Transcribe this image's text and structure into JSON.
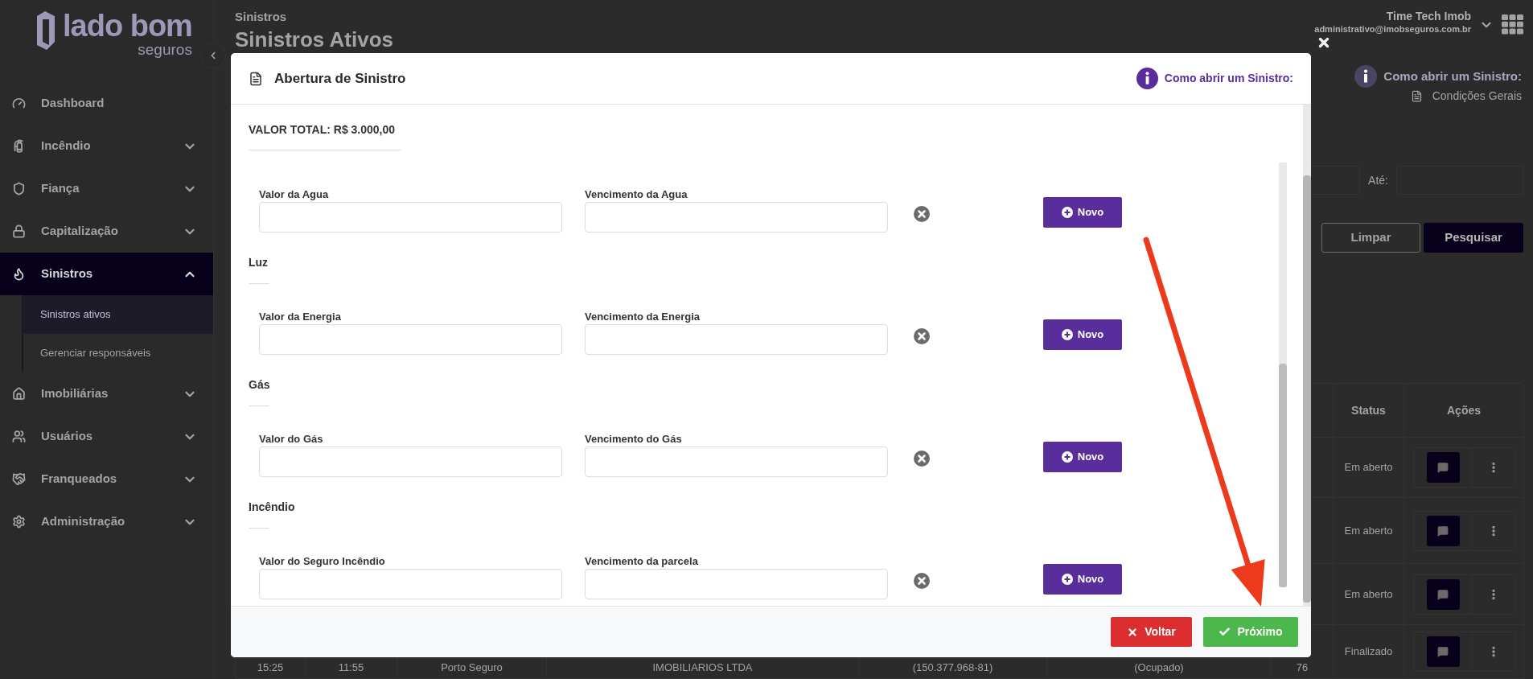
{
  "sidebar": {
    "logo": {
      "wordmark": "lado bom",
      "tagline": "seguros"
    },
    "items": [
      {
        "label": "Dashboard",
        "expandable": false,
        "selected": false
      },
      {
        "label": "Incêndio",
        "expandable": true,
        "expanded": false,
        "selected": false
      },
      {
        "label": "Fiança",
        "expandable": true,
        "expanded": false,
        "selected": false
      },
      {
        "label": "Capitalização",
        "expandable": true,
        "expanded": false,
        "selected": false
      },
      {
        "label": "Sinistros",
        "expandable": true,
        "expanded": true,
        "selected": true,
        "children": [
          {
            "label": "Sinistros ativos",
            "selected": true
          },
          {
            "label": "Gerenciar responsáveis",
            "selected": false
          }
        ]
      },
      {
        "label": "Imobiliárias",
        "expandable": true,
        "expanded": false,
        "selected": false
      },
      {
        "label": "Usuários",
        "expandable": true,
        "expanded": false,
        "selected": false
      },
      {
        "label": "Franqueados",
        "expandable": true,
        "expanded": false,
        "selected": false
      },
      {
        "label": "Administração",
        "expandable": true,
        "expanded": false,
        "selected": false
      }
    ]
  },
  "header": {
    "breadcrumb": "Sinistros",
    "title": "Sinistros Ativos",
    "user": {
      "name": "Time Tech Imob",
      "email": "administrativo@imobseguros.com.br"
    }
  },
  "help": {
    "label": "Como abrir um Sinistro:",
    "link": "Condições Gerais"
  },
  "filters": {
    "until_label": "Até:",
    "buttons": [
      {
        "label": "Limpar",
        "kind": "outline"
      },
      {
        "label": "Pesquisar",
        "kind": "primary"
      }
    ]
  },
  "table": {
    "columns": [
      "Status",
      "Ações"
    ],
    "rows": [
      {
        "status": "Em aberto",
        "cells": []
      },
      {
        "status": "Em aberto",
        "cells": []
      },
      {
        "status": "Em aberto",
        "cells": []
      },
      {
        "status": "Finalizado",
        "cells": [
          [
            "15:25"
          ],
          [
            "11:55"
          ],
          [
            "Porto Seguro"
          ],
          [
            "IMOBILIARIOS LTDA"
          ],
          [
            "(150.377.968-81)"
          ],
          [
            "(Ocupado)"
          ],
          [
            "76"
          ]
        ]
      }
    ]
  },
  "modal": {
    "title": "Abertura de Sinistro",
    "help_link": "Como abrir um Sinistro:",
    "total": "VALOR TOTAL: R$ 3.000,00",
    "sections": [
      {
        "fields": [
          {
            "label": "Valor da Agua"
          },
          {
            "label": "Vencimento da Agua"
          }
        ],
        "action": "Novo"
      },
      {
        "heading": "Luz",
        "fields": [
          {
            "label": "Valor da Energia"
          },
          {
            "label": "Vencimento da Energia"
          }
        ],
        "action": "Novo"
      },
      {
        "heading": "Gás",
        "fields": [
          {
            "label": "Valor do Gás"
          },
          {
            "label": "Vencimento do Gás"
          }
        ],
        "action": "Novo"
      },
      {
        "heading": "Incêndio",
        "fields": [
          {
            "label": "Valor do Seguro Incêndio"
          },
          {
            "label": "Vencimento da parcela"
          }
        ],
        "action": "Novo"
      }
    ],
    "buttons": [
      {
        "label": "Voltar",
        "kind": "danger"
      },
      {
        "label": "Próximo",
        "kind": "success"
      }
    ]
  }
}
